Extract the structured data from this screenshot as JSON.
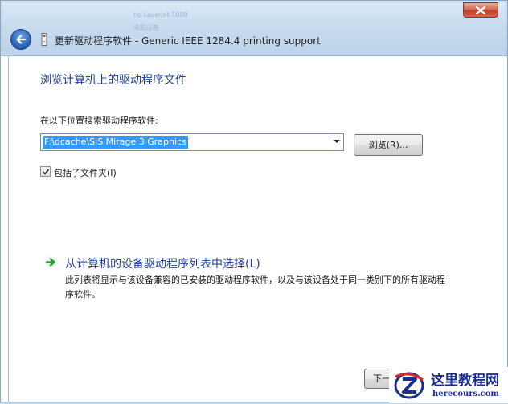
{
  "window": {
    "title": "更新驱动程序软件 - Generic IEEE 1284.4 printing support",
    "background_ghost_1": "hp LaserJet 1000",
    "background_ghost_2": "未知设备"
  },
  "content": {
    "heading": "浏览计算机上的驱动程序文件",
    "search_label": "在以下位置搜索驱动程序软件:",
    "path_value": "F:\\dcache\\SiS Mirage 3 Graphics",
    "browse_label": "浏览(R)...",
    "include_subfolders_label": "包括子文件夹(I)",
    "include_subfolders_checked": true,
    "pick_list_title": "从计算机的设备驱动程序列表中选择(L)",
    "pick_list_desc": "此列表将显示与该设备兼容的已安装的驱动程序软件，以及与该设备处于同一类别下的所有驱动程序软件。",
    "next_label": "下一步(N)"
  },
  "watermark": {
    "title": "这里教程网",
    "site": "herecours.com"
  },
  "colors": {
    "heading": "#1f3f90",
    "selection": "#3399ff",
    "close": "#c0402b",
    "link_arrow": "#2e9a3a",
    "watermark": "#1c2d8c"
  },
  "icons": {
    "back": "back-arrow-icon",
    "close": "close-icon",
    "title": "device-icon",
    "link": "green-arrow-icon",
    "dropdown": "chevron-down-icon",
    "check": "checkmark-icon"
  }
}
